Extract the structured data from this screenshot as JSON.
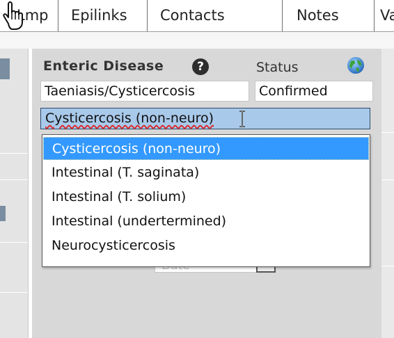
{
  "tabs": [
    {
      "label": "Lmp"
    },
    {
      "label": "Epilinks"
    },
    {
      "label": "Contacts"
    },
    {
      "label": "Notes"
    },
    {
      "label": "Va"
    }
  ],
  "form": {
    "disease_label": "Enteric Disease",
    "status_label": "Status",
    "disease_value": "Taeniasis/Cysticercosis",
    "status_value": "Confirmed",
    "subtype_selected": "Cysticercosis (non-neuro)",
    "date_placeholder": "Date"
  },
  "dropdown": {
    "options": [
      {
        "label": "Cysticercosis (non-neuro)",
        "selected": true
      },
      {
        "label": "Intestinal (T. saginata)",
        "selected": false
      },
      {
        "label": "Intestinal (T. solium)",
        "selected": false
      },
      {
        "label": "Intestinal (undertermined)",
        "selected": false
      },
      {
        "label": "Neurocysticercosis",
        "selected": false
      }
    ]
  },
  "icons": {
    "help": "help-icon",
    "globe": "globe-icon",
    "cursor": "hand-cursor-icon",
    "text_cursor": "ibeam-cursor-icon",
    "calendar": "calendar-icon"
  },
  "help_glyph": "?",
  "colors": {
    "selection": "#3399ff",
    "select_field": "#a8c9ea",
    "panel": "#d8d8d8"
  }
}
